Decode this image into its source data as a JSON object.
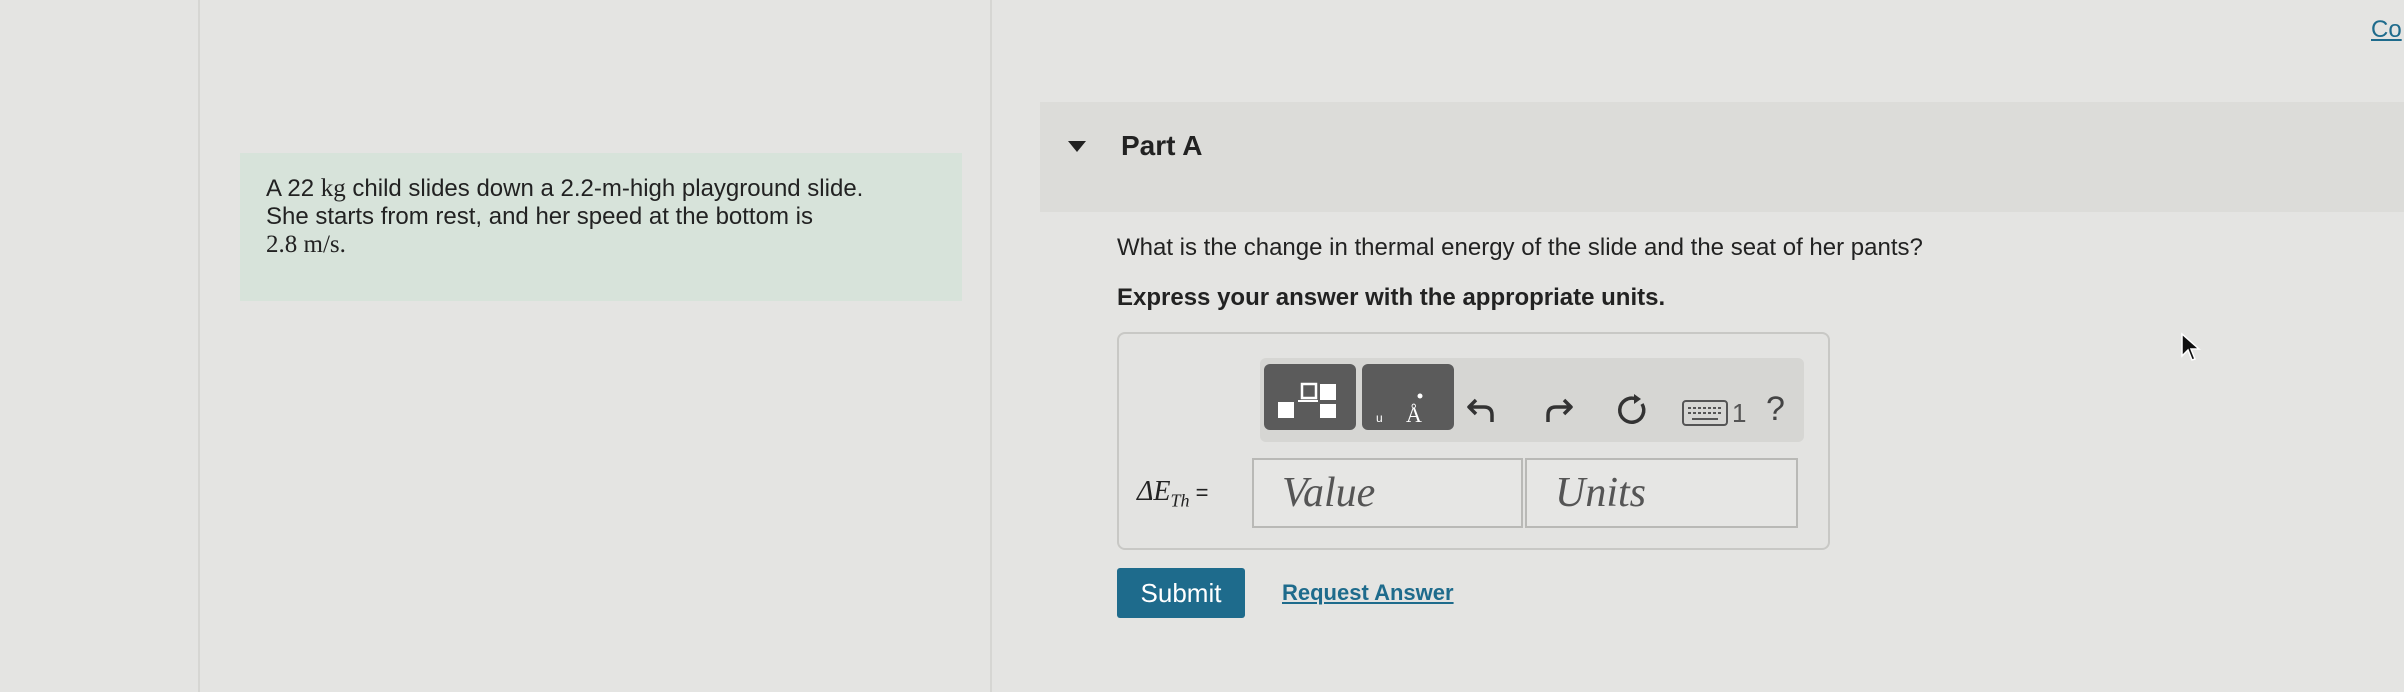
{
  "top_link": "Co",
  "problem": {
    "line1_pre": "A 22 ",
    "line1_unit": "kg",
    "line1_post": " child slides down a 2.2-m-high playground slide.",
    "line2": "She starts from rest, and her speed at the bottom is",
    "line3_value": "2.8 m/s."
  },
  "part": {
    "title": "Part A"
  },
  "question": "What is the change in thermal energy of the slide and the seat of her pants?",
  "instruction": "Express your answer with the appropriate units.",
  "toolbar": {
    "icons": [
      "templates-icon",
      "units-icon",
      "undo-icon",
      "redo-icon",
      "reset-icon",
      "keyboard-icon",
      "help-icon"
    ],
    "keyboard_label": "1",
    "help_label": "?"
  },
  "equation": {
    "symbol": "ΔE",
    "subscript": "Th",
    "equals": " ="
  },
  "inputs": {
    "value_placeholder": "Value",
    "units_placeholder": "Units"
  },
  "actions": {
    "submit_label": "Submit",
    "request_label": "Request Answer"
  },
  "colors": {
    "accent": "#1e6b8c",
    "problem_bg": "#d7e3da",
    "toolbar_btn": "#5b5b5b"
  }
}
